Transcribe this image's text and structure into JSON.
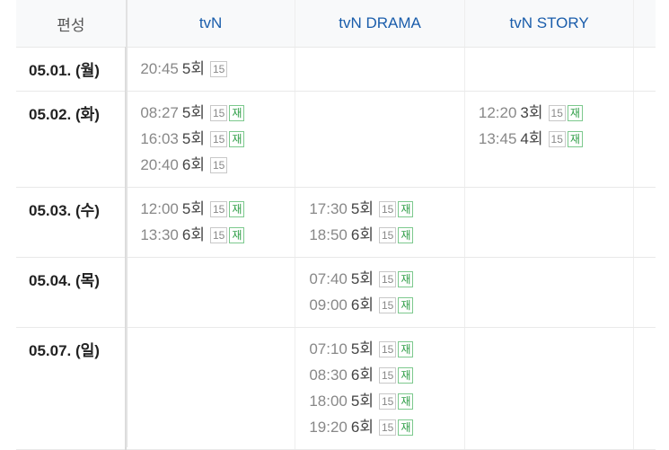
{
  "header": {
    "label": "편성",
    "channels": [
      "tvN",
      "tvN DRAMA",
      "tvN STORY"
    ]
  },
  "badges": {
    "rating": "15",
    "rerun": "재"
  },
  "rows": [
    {
      "date": "05.01. (월)",
      "channels": [
        [
          {
            "time": "20:45",
            "episode": "5회",
            "rerun": false
          }
        ],
        [],
        []
      ]
    },
    {
      "date": "05.02. (화)",
      "channels": [
        [
          {
            "time": "08:27",
            "episode": "5회",
            "rerun": true
          },
          {
            "time": "16:03",
            "episode": "5회",
            "rerun": true
          },
          {
            "time": "20:40",
            "episode": "6회",
            "rerun": false
          }
        ],
        [],
        [
          {
            "time": "12:20",
            "episode": "3회",
            "rerun": true
          },
          {
            "time": "13:45",
            "episode": "4회",
            "rerun": true
          }
        ]
      ]
    },
    {
      "date": "05.03. (수)",
      "channels": [
        [
          {
            "time": "12:00",
            "episode": "5회",
            "rerun": true
          },
          {
            "time": "13:30",
            "episode": "6회",
            "rerun": true
          }
        ],
        [
          {
            "time": "17:30",
            "episode": "5회",
            "rerun": true
          },
          {
            "time": "18:50",
            "episode": "6회",
            "rerun": true
          }
        ],
        []
      ]
    },
    {
      "date": "05.04. (목)",
      "channels": [
        [],
        [
          {
            "time": "07:40",
            "episode": "5회",
            "rerun": true
          },
          {
            "time": "09:00",
            "episode": "6회",
            "rerun": true
          }
        ],
        []
      ]
    },
    {
      "date": "05.07. (일)",
      "channels": [
        [],
        [
          {
            "time": "07:10",
            "episode": "5회",
            "rerun": true
          },
          {
            "time": "08:30",
            "episode": "6회",
            "rerun": true
          },
          {
            "time": "18:00",
            "episode": "5회",
            "rerun": true
          },
          {
            "time": "19:20",
            "episode": "6회",
            "rerun": true
          }
        ],
        []
      ]
    }
  ]
}
